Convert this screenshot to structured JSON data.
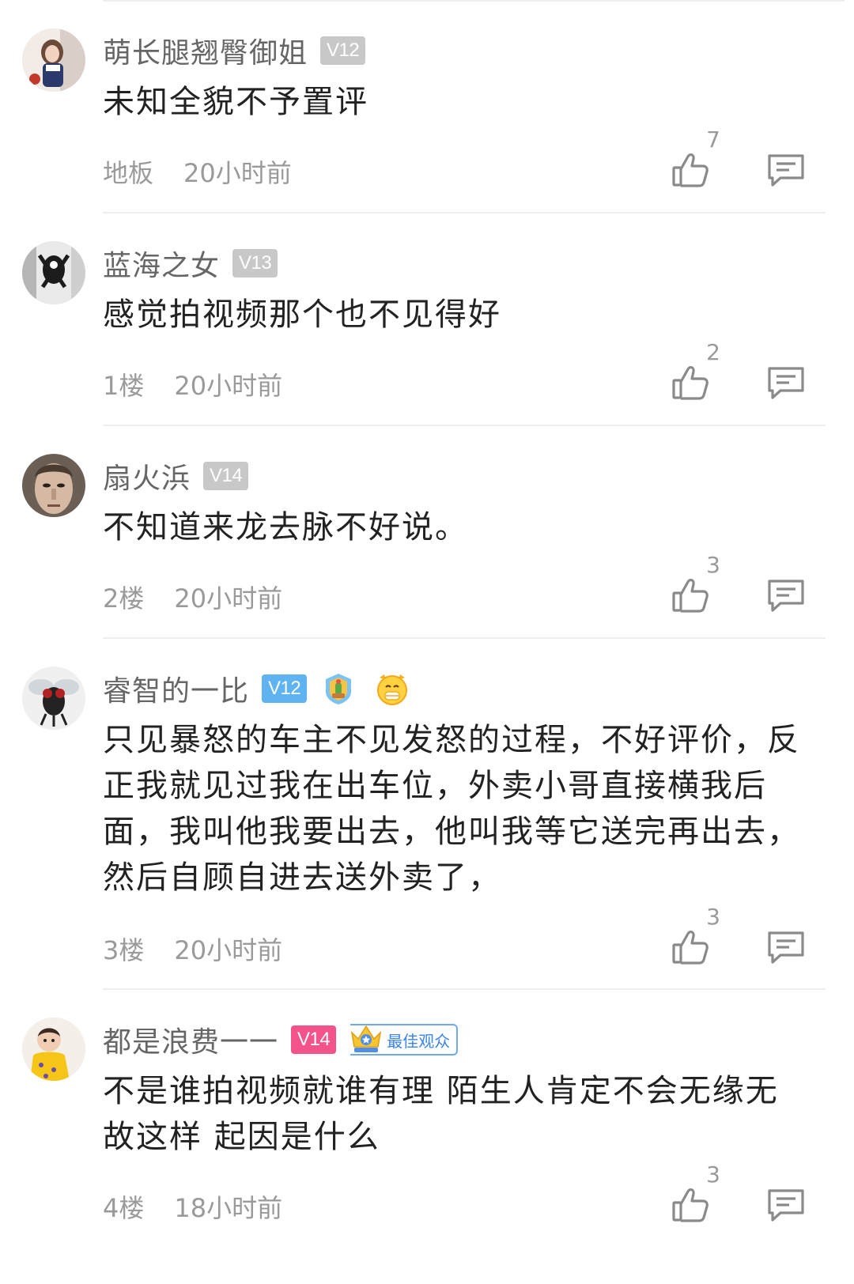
{
  "comments": [
    {
      "username": "萌长腿翘臀御姐",
      "vip": "V12",
      "vip_color": "#c8c8c8",
      "content": "未知全貌不予置评",
      "floor": "地板",
      "time": "20小时前",
      "likes": "7"
    },
    {
      "username": "蓝海之女",
      "vip": "V13",
      "vip_color": "#c8c8c8",
      "content": "感觉拍视频那个也不见得好",
      "floor": "1楼",
      "time": "20小时前",
      "likes": "2"
    },
    {
      "username": "扇火浜",
      "vip": "V14",
      "vip_color": "#c8c8c8",
      "content": "不知道来龙去脉不好说。",
      "floor": "2楼",
      "time": "20小时前",
      "likes": "3"
    },
    {
      "username": "睿智的一比",
      "vip": "V12",
      "vip_color": "#5fb3f0",
      "content": "只见暴怒的车主不见发怒的过程，不好评价，反正我就见过我在出车位，外卖小哥直接横我后面，我叫他我要出去，他叫我等它送完再出去，然后自顾自进去送外卖了，",
      "floor": "3楼",
      "time": "20小时前",
      "likes": "3",
      "medals": [
        "plant-medal-icon",
        "smile-star-medal-icon"
      ]
    },
    {
      "username": "都是浪费一一",
      "vip": "V14",
      "vip_color": "#f2538b",
      "content": "不是谁拍视频就谁有理 陌生人肯定不会无缘无故这样 起因是什么",
      "floor": "4楼",
      "time": "18小时前",
      "likes": "3",
      "best_badge": "最佳观众"
    }
  ]
}
